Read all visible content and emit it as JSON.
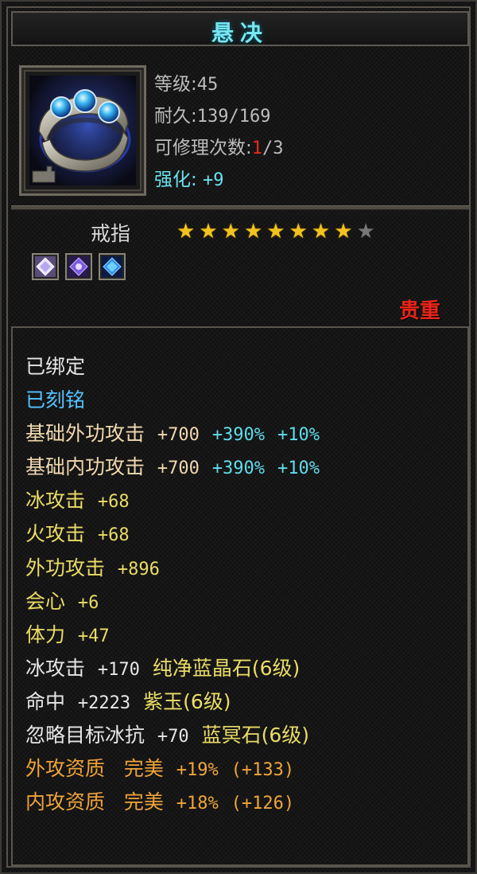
{
  "title": "悬决",
  "item": {
    "level_label": "等级:",
    "level_value": "45",
    "durability_label": "耐久:",
    "durability_value": "139/169",
    "repair_label": "可修理次数:",
    "repair_used": "1",
    "repair_total": "/3",
    "enhance_label": "强化:",
    "enhance_value": "+9",
    "type": "戒指",
    "stars_total": 9,
    "stars_filled": 8,
    "rarity": "贵重",
    "icon": "ring-with-blue-gems-icon",
    "gems": [
      "white-gem-icon",
      "purple-gem-icon",
      "blue-gem-icon"
    ]
  },
  "colors": {
    "title": "#78e6f0",
    "rarity": "#e8261a",
    "bound": "#e6e6e6",
    "engraved": "#55c2ff",
    "base": "#f0d9b0",
    "bonus": "#5fdceb",
    "stat": "#eadc66",
    "quality": "#f0a43a"
  },
  "attributes": {
    "bound": "已绑定",
    "engraved": "已刻铭",
    "base_outer_label": "基础外功攻击",
    "base_outer_value": "+700",
    "base_outer_pct1": "+390%",
    "base_outer_pct2": "+10%",
    "base_inner_label": "基础内功攻击",
    "base_inner_value": "+700",
    "base_inner_pct1": "+390%",
    "base_inner_pct2": "+10%",
    "ice_attack_label": "冰攻击",
    "ice_attack_value": "+68",
    "fire_attack_label": "火攻击",
    "fire_attack_value": "+68",
    "outer_attack_label": "外功攻击",
    "outer_attack_value": "+896",
    "crit_label": "会心",
    "crit_value": "+6",
    "stamina_label": "体力",
    "stamina_value": "+47",
    "gem1_label": "冰攻击",
    "gem1_value": "+170",
    "gem1_name": "纯净蓝晶石(6级)",
    "gem2_label": "命中",
    "gem2_value": "+2223",
    "gem2_name": "紫玉(6级)",
    "gem3_label": "忽略目标冰抗",
    "gem3_value": "+70",
    "gem3_name": "蓝冥石(6级)",
    "q1_label": "外攻资质",
    "q1_grade": "完美",
    "q1_pct": "+19%",
    "q1_bonus": "(+133)",
    "q2_label": "内攻资质",
    "q2_grade": "完美",
    "q2_pct": "+18%",
    "q2_bonus": "(+126)"
  }
}
